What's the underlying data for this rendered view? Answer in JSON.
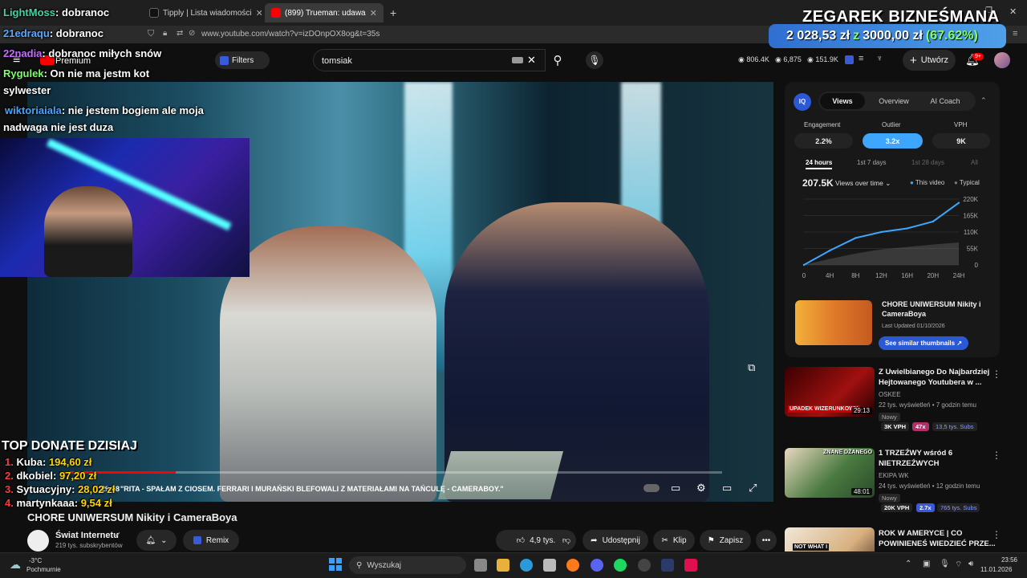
{
  "browser": {
    "tabs": [
      {
        "label": "Tipply | Lista wiadomości",
        "close": "✕"
      },
      {
        "label": "(899) Trueman: udawany milion",
        "close": "✕"
      }
    ],
    "new_tab": "+",
    "url": "www.youtube.com/watch?v=izDOnpOX8og&t=35s"
  },
  "youtube": {
    "premium_label": "Premium",
    "filters_label": "Filters",
    "search_value": "tomsiak",
    "stats": [
      "806.4K",
      "6,875",
      "151.9K"
    ],
    "create_label": "Utwórz",
    "notif_badge": "9+"
  },
  "overlay_chat": [
    {
      "user": "LightMoss",
      "msg": ": dobranoc"
    },
    {
      "user": "21edraqu",
      "msg": ": dobranoc"
    },
    {
      "user": "22nadia",
      "msg": ": dobranoc miłych snów"
    },
    {
      "user": "Rygulek",
      "msg": ": On nie ma jestm kot"
    },
    {
      "user": "",
      "msg": "sylwester"
    },
    {
      "user": "wiktoriaiala",
      "msg": ": nie jestem bogiem ale moja"
    },
    {
      "user": "",
      "msg": "nadwaga nie jest duza"
    }
  ],
  "zegarek": {
    "title": "ZEGAREK BIZNEŚMANA",
    "current": "2 028,53 zł",
    "sep": "z",
    "goal": "3000,00 zł",
    "percent": "(67.62%)"
  },
  "donate": {
    "title": "TOP DONATE DZISIAJ",
    "items": [
      {
        "n": "1.",
        "user": "Kuba:",
        "amount": "194,60 zł"
      },
      {
        "n": "2.",
        "user": "dkobiel:",
        "amount": "97,20 zł"
      },
      {
        "n": "3.",
        "user": "Sytuacyjny:",
        "amount": "28,02 zł"
      },
      {
        "n": "4.",
        "user": "martynkaaa:",
        "amount": "9,54 zł"
      }
    ]
  },
  "player": {
    "time": "1:29:58",
    "chapter": "\"RITA - SPAŁAM Z CIOSEM. FERRARI I MURAŃSKI BLEFOWALI Z MATERIAŁAMI NA TAŃCULĘ - CAMERABOY.\"",
    "progress": 0.17
  },
  "video": {
    "title": "CHORE UNIWERSUM Nikity i CameraBoya",
    "channel": "Świat Internetu",
    "subs": "219 tys. subskrybentów",
    "remix": "Remix",
    "likes": "4,9 tys.",
    "share": "Udostępnij",
    "clip": "Klip",
    "save": "Zapisz",
    "more": "•••"
  },
  "iq_panel": {
    "logo": "IQ",
    "tabs": [
      "Views",
      "Overview",
      "AI Coach"
    ],
    "metrics": [
      {
        "label": "Engagement",
        "value": "2.2%"
      },
      {
        "label": "Outlier",
        "value": "3.2x"
      },
      {
        "label": "VPH",
        "value": "9K"
      }
    ],
    "ranges": [
      "24 hours",
      "1st 7 days",
      "1st 28 days",
      "All"
    ],
    "views": "207.5K",
    "views_mode": "Views over time",
    "legend": [
      "This video",
      "Typical"
    ],
    "card_title": "CHORE UNIWERSUM Nikity i CameraBoya",
    "card_updated": "Last Updated 01/10/2026",
    "card_button": "See similar thumbnails"
  },
  "chart_data": {
    "type": "line",
    "x": [
      "0",
      "4H",
      "8H",
      "12H",
      "16H",
      "20H",
      "24H"
    ],
    "ylim": [
      0,
      220000
    ],
    "yticks": [
      "0",
      "55K",
      "110K",
      "165K",
      "220K"
    ],
    "series": [
      {
        "name": "This video",
        "values": [
          0,
          48000,
          90000,
          110000,
          122000,
          145000,
          207500
        ]
      },
      {
        "name": "Typical",
        "values": [
          0,
          20000,
          38000,
          52000,
          60000,
          68000,
          75000
        ]
      }
    ]
  },
  "recommendations": [
    {
      "title": "Z Uwielbianego Do Najbardziej Hejtowanego Youtubera w ...",
      "channel": "OSKEE",
      "meta": "22 tys. wyświetleń • 7 godzin temu",
      "new": "Nowy",
      "vph": "3K VPH",
      "ratio": "47x",
      "subs": "13,5 tys. Subs",
      "duration": "29:13",
      "thumb_text": "UPADEK WIZERUNKOWY"
    },
    {
      "title": "1 TRZEŹWY wśród 6 NIETRZEŹWYCH",
      "channel": "EKIPA WK",
      "meta": "24 tys. wyświetleń • 12 godzin temu",
      "new": "Nowy",
      "vph": "20K VPH",
      "ratio": "2.7x",
      "subs": "765 tys. Subs",
      "duration": "48:01",
      "thumb_text": "ZNANE DŻANEGO"
    },
    {
      "title": "ROK W AMERYCE | CO POWINIENEŚ WIEDZIEĆ PRZE...",
      "channel": "",
      "meta": "",
      "new": "",
      "vph": "",
      "ratio": "",
      "subs": "",
      "duration": "",
      "thumb_text": "NOT WHAT I"
    }
  ],
  "taskbar": {
    "weather_temp": "-3°C",
    "weather_desc": "Pochmurnie",
    "search": "Wyszukaj",
    "time": "23:56",
    "date": "11.01.2026"
  }
}
